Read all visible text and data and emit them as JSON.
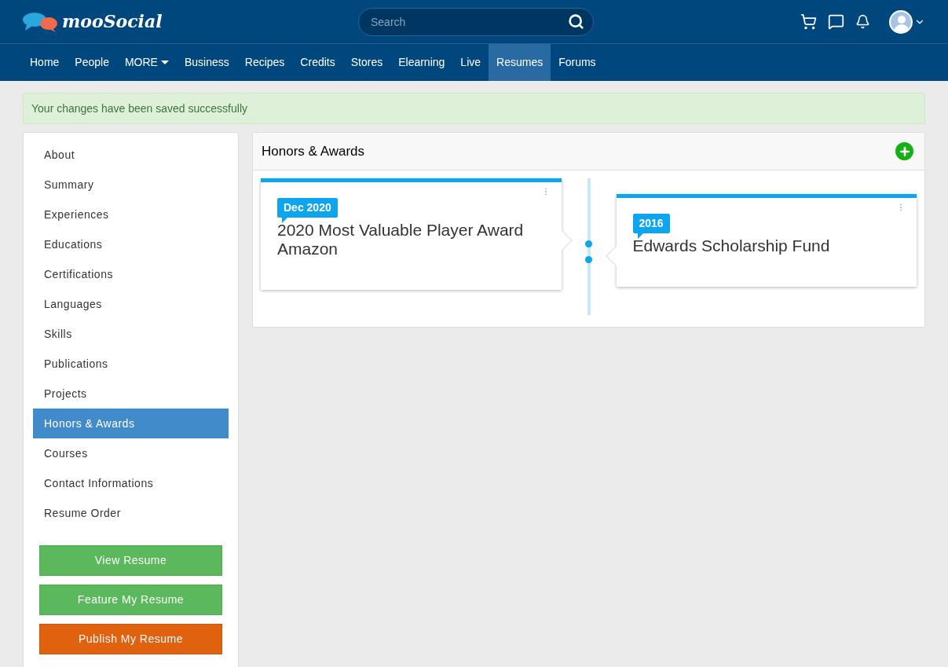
{
  "header": {
    "logo": "mooSocial",
    "search": {
      "placeholder": "Search"
    }
  },
  "nav": [
    {
      "label": "Home",
      "selected": false
    },
    {
      "label": "People",
      "selected": false
    },
    {
      "label": "MORE",
      "selected": false,
      "dropdown": true
    },
    {
      "label": "Business",
      "selected": false
    },
    {
      "label": "Recipes",
      "selected": false
    },
    {
      "label": "Credits",
      "selected": false
    },
    {
      "label": "Stores",
      "selected": false
    },
    {
      "label": "Elearning",
      "selected": false
    },
    {
      "label": "Live",
      "selected": false
    },
    {
      "label": "Resumes",
      "selected": true
    },
    {
      "label": "Forums",
      "selected": false
    }
  ],
  "alert": "Your changes have been saved successfully",
  "sidebar": {
    "items": [
      {
        "label": "About",
        "selected": false
      },
      {
        "label": "Summary",
        "selected": false
      },
      {
        "label": "Experiences",
        "selected": false
      },
      {
        "label": "Educations",
        "selected": false
      },
      {
        "label": "Certifications",
        "selected": false
      },
      {
        "label": "Languages",
        "selected": false
      },
      {
        "label": "Skills",
        "selected": false
      },
      {
        "label": "Publications",
        "selected": false
      },
      {
        "label": "Projects",
        "selected": false
      },
      {
        "label": "Honors & Awards",
        "selected": true
      },
      {
        "label": "Courses",
        "selected": false
      },
      {
        "label": "Contact Informations",
        "selected": false
      },
      {
        "label": "Resume Order",
        "selected": false
      }
    ],
    "buttons": [
      {
        "label": "View Resume",
        "kind": "success"
      },
      {
        "label": "Feature My Resume",
        "kind": "success"
      },
      {
        "label": "Publish My Resume",
        "kind": "warning"
      }
    ]
  },
  "panel": {
    "title": "Honors & Awards",
    "entries": [
      {
        "date": "Dec 2020",
        "title": "2020 Most Valuable Player Award Amazon"
      },
      {
        "date": "2016",
        "title": "Edwards Scholarship Fund"
      }
    ]
  }
}
